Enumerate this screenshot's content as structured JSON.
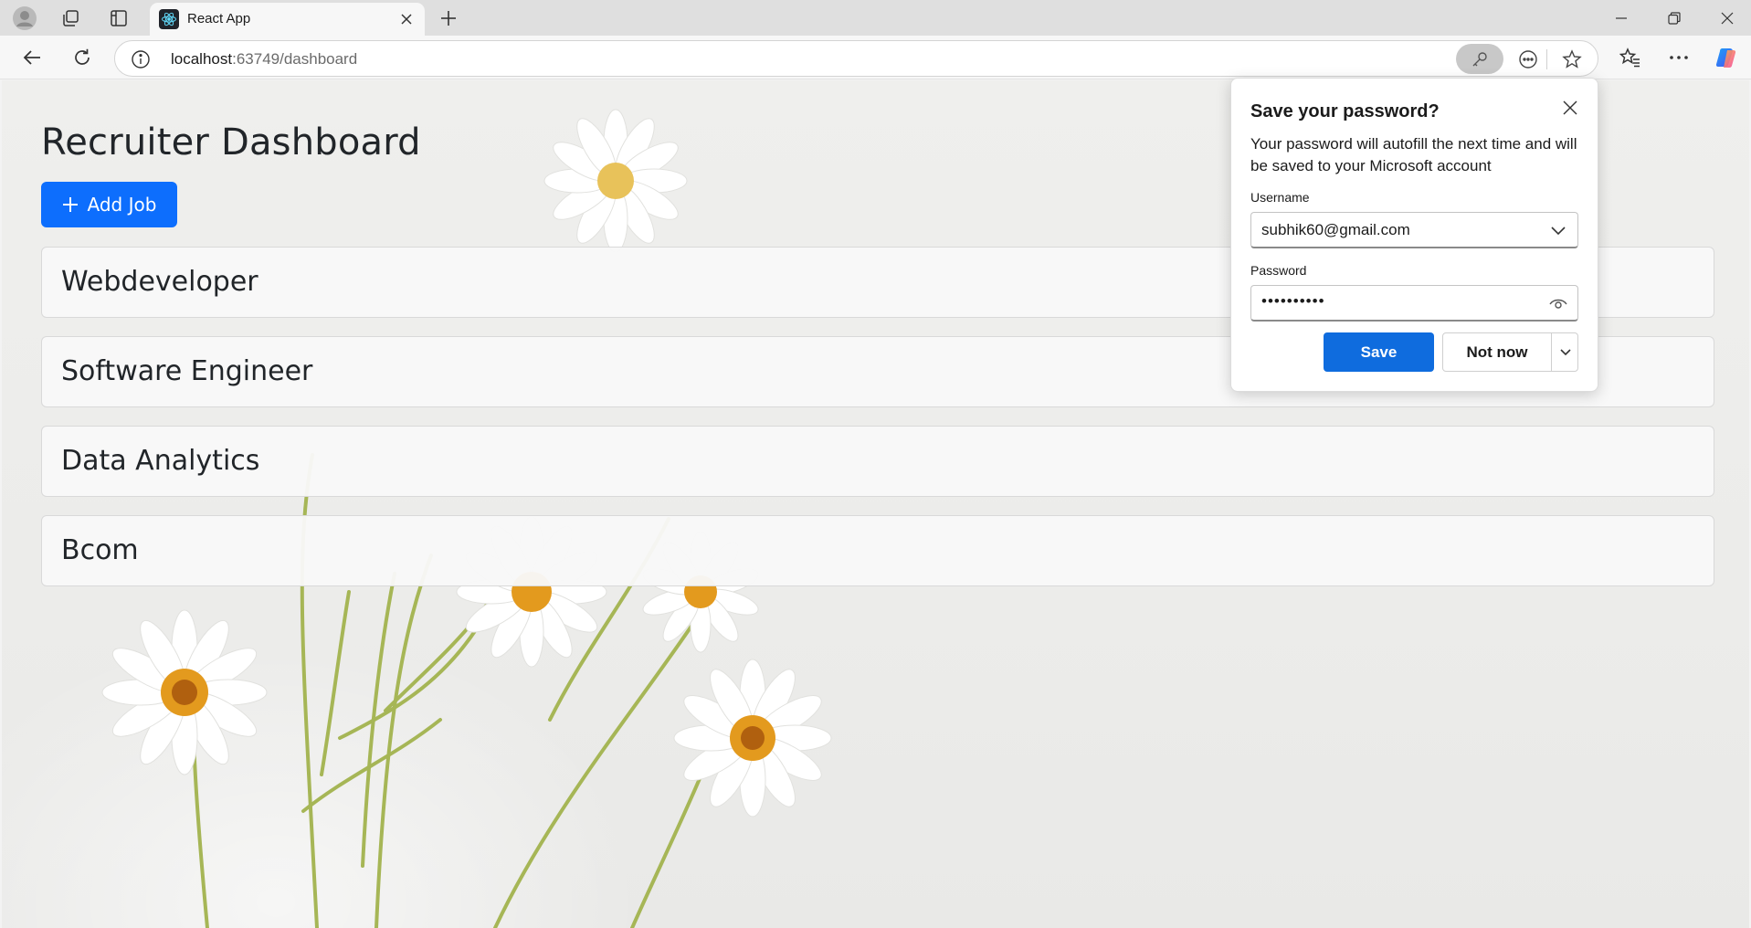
{
  "browser": {
    "tab": {
      "title": "React App",
      "favicon": "react-logo"
    },
    "address_bar": {
      "host": "localhost",
      "rest": ":63749/dashboard"
    },
    "icons": [
      "profile-icon",
      "workspaces-icon",
      "tab-actions-icon",
      "new-tab-icon",
      "minimize-icon",
      "restore-icon",
      "close-window-icon",
      "back-icon",
      "refresh-icon",
      "site-info-icon",
      "password-key-icon",
      "browser-essentials-icon",
      "favorite-star-icon",
      "favorites-icon",
      "more-options-icon",
      "copilot-icon"
    ]
  },
  "page": {
    "title": "Recruiter Dashboard",
    "add_job_label": "Add Job",
    "jobs": [
      "Webdeveloper",
      "Software Engineer",
      "Data Analytics",
      "Bcom"
    ]
  },
  "password_popup": {
    "title": "Save your password?",
    "description": "Your password will autofill the next time and will be saved to your Microsoft account",
    "username_label": "Username",
    "username_value": "subhik60@gmail.com",
    "password_label": "Password",
    "password_value": "••••••••••",
    "save_label": "Save",
    "not_now_label": "Not now"
  },
  "colors": {
    "primary_button": "#0d6efd",
    "save_button": "#0f6cde",
    "popup_bg": "#ffffff"
  }
}
